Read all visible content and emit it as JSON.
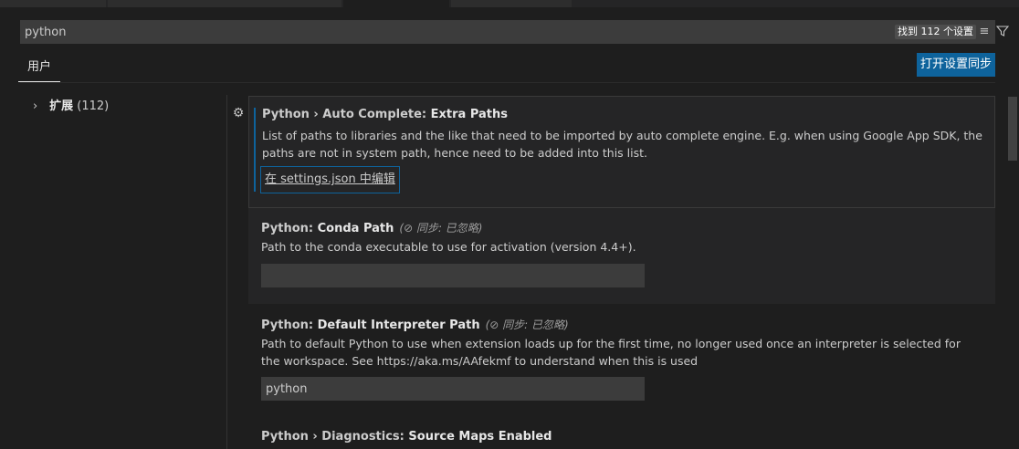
{
  "search": {
    "value": "python",
    "result_count": "找到 112 个设置",
    "clear_filter_icon": "clear-filter-icon",
    "filter_icon": "filter-icon"
  },
  "tabs": {
    "user": "用户"
  },
  "sync_button": "打开设置同步",
  "toc": {
    "chevron": "›",
    "label": "扩展",
    "count": "(112)"
  },
  "settings": [
    {
      "category": "Python › Auto Complete: ",
      "name": "Extra Paths",
      "description": "List of paths to libraries and the like that need to be imported by auto complete engine. E.g. when using Google App SDK, the paths are not in system path, hence need to be added into this list.",
      "edit_link": "在 settings.json 中编辑"
    },
    {
      "category": "Python: ",
      "name": "Conda Path",
      "sync_status": "(⊘ 同步: 已忽略)",
      "description": "Path to the conda executable to use for activation (version 4.4+).",
      "value": ""
    },
    {
      "category": "Python: ",
      "name": "Default Interpreter Path",
      "sync_status": "(⊘ 同步: 已忽略)",
      "description": "Path to default Python to use when extension loads up for the first time, no longer used once an interpreter is selected for the workspace. See https://aka.ms/AAfekmf to understand when this is used",
      "value": "python"
    },
    {
      "category": "Python › Diagnostics: ",
      "name": "Source Maps Enabled"
    }
  ],
  "icons": {
    "gear": "gear-icon",
    "clear_filter": "clear-filter-icon",
    "filter": "filter-icon"
  },
  "colors": {
    "accent": "#0e639c",
    "background": "#1e1e1e",
    "input": "#3c3c3c"
  }
}
